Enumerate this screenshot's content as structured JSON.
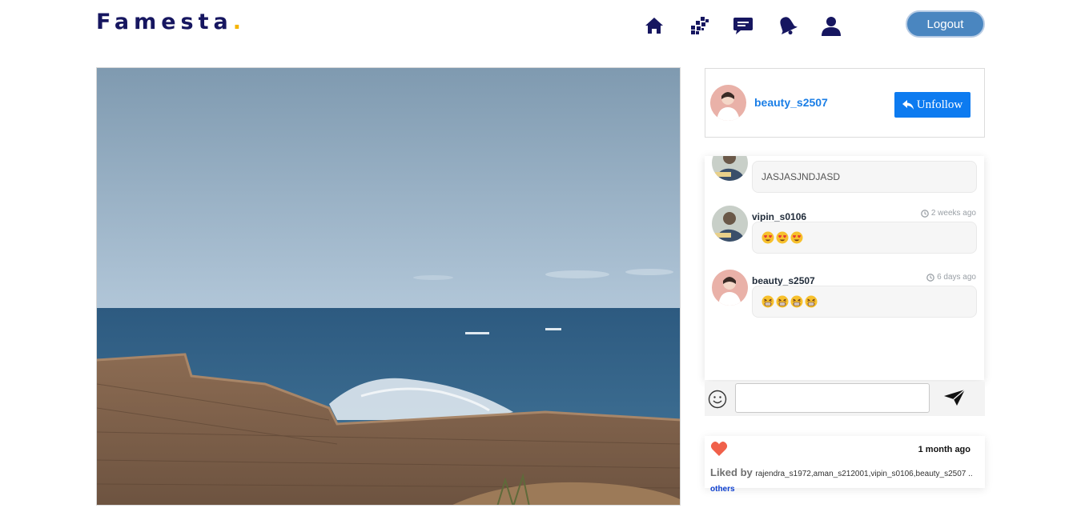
{
  "header": {
    "brand": "Famesta",
    "brand_dot": ".",
    "logout_label": "Logout"
  },
  "nav": {
    "icons": [
      "home-icon",
      "explore-icon",
      "messages-icon",
      "notifications-icon",
      "profile-icon"
    ]
  },
  "author": {
    "username": "beauty_s2507",
    "unfollow_label": "Unfollow"
  },
  "comments": [
    {
      "username": "vipin_s0106",
      "time": "",
      "text": "JASJASJNDJASD",
      "emoji": null
    },
    {
      "username": "vipin_s0106",
      "time": "2 weeks ago",
      "text": "",
      "emoji": "heart-eyes-emoji"
    },
    {
      "username": "beauty_s2507",
      "time": "6 days ago",
      "text": "",
      "emoji": "grinning-squint-emoji"
    }
  ],
  "comment_input": {
    "placeholder": "",
    "value": ""
  },
  "likes": {
    "time": "1 month ago",
    "liked_by_label": "Liked by",
    "names": "rajendra_s1972,aman_s212001,vipin_s0106,beauty_s2507 ..",
    "others_label": "others"
  },
  "colors": {
    "brand": "#161660",
    "brand_dot": "#f5b400",
    "logout": "#4a86c0",
    "unfollow": "#0d7bf0",
    "username_link": "#1a7ee6",
    "heart": "#f0604a"
  }
}
